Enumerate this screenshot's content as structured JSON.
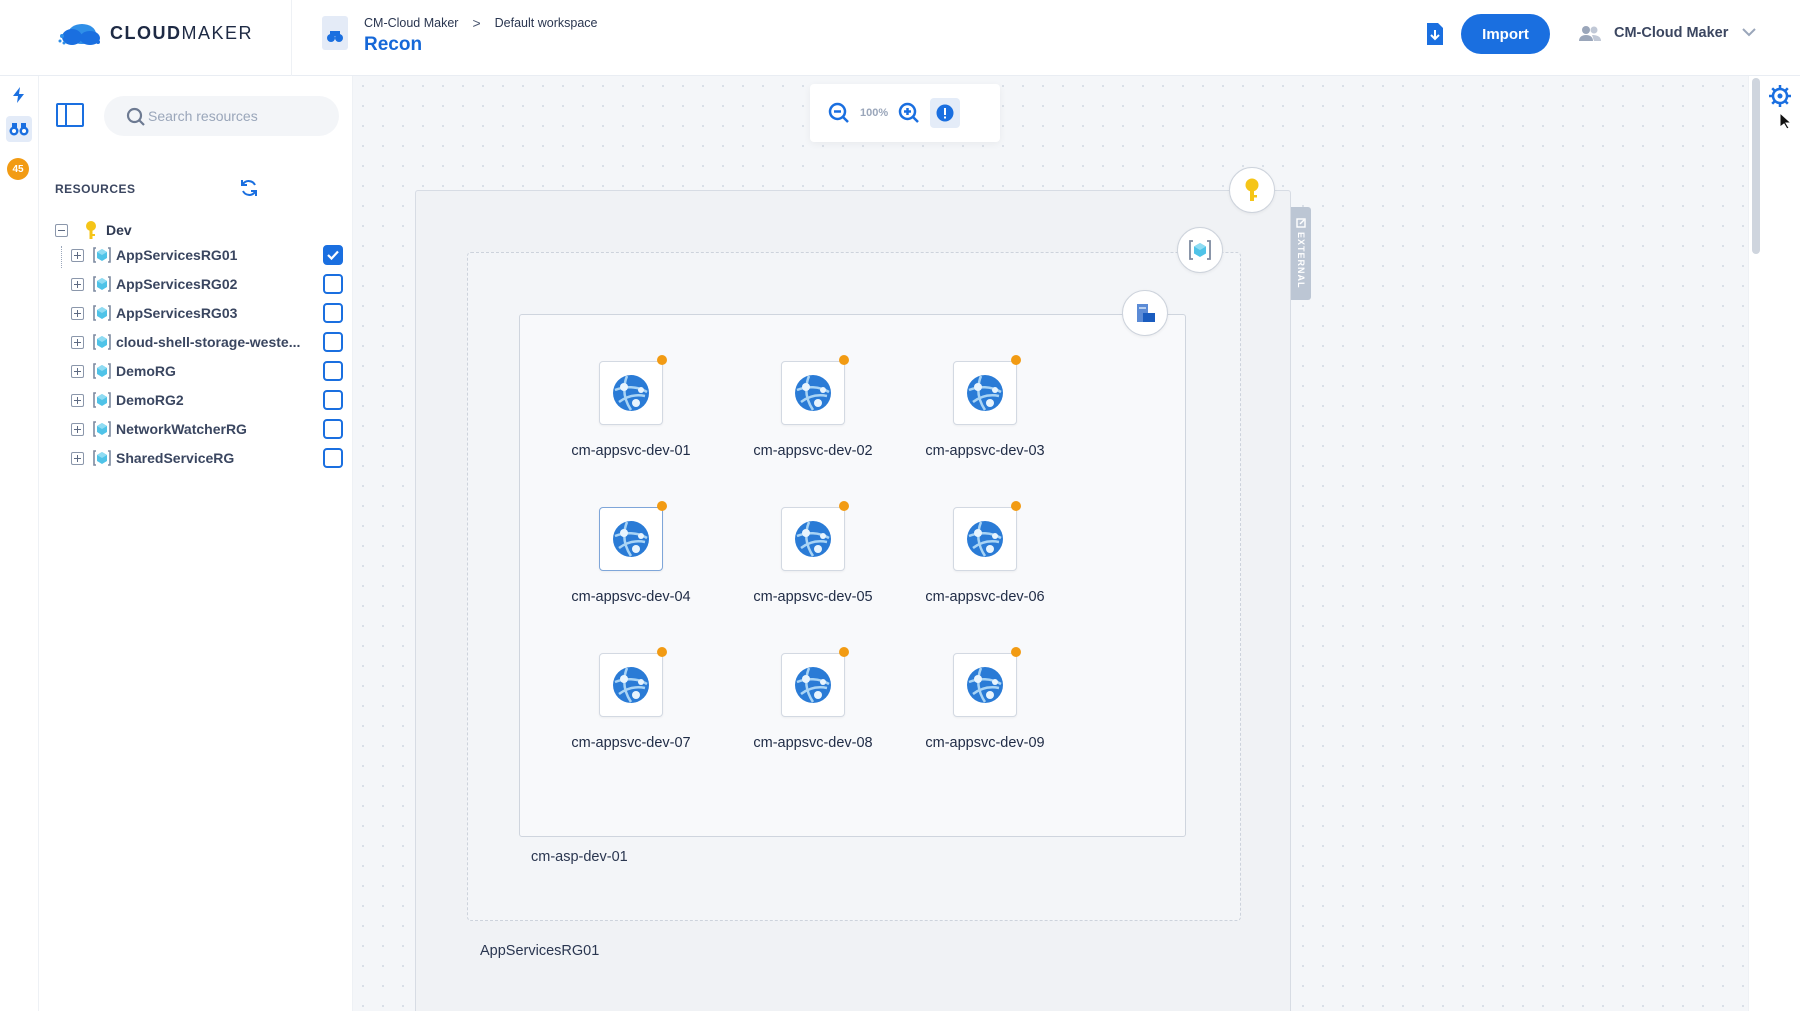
{
  "app": {
    "logo_text_bold": "CLOUD",
    "logo_text_light": "MAKER"
  },
  "header": {
    "breadcrumb_parent": "CM-Cloud Maker",
    "breadcrumb_separator": ">",
    "breadcrumb_current": "Default workspace",
    "page_title": "Recon",
    "import_label": "Import",
    "user_name": "CM-Cloud Maker"
  },
  "rail": {
    "badge_count": "45"
  },
  "sidebar": {
    "search_placeholder": "Search resources",
    "resources_label": "RESOURCES",
    "root_label": "Dev",
    "items": [
      {
        "label": "AppServicesRG01",
        "checked": true
      },
      {
        "label": "AppServicesRG02",
        "checked": false
      },
      {
        "label": "AppServicesRG03",
        "checked": false
      },
      {
        "label": "cloud-shell-storage-weste...",
        "checked": false
      },
      {
        "label": "DemoRG",
        "checked": false
      },
      {
        "label": "DemoRG2",
        "checked": false
      },
      {
        "label": "NetworkWatcherRG",
        "checked": false
      },
      {
        "label": "SharedServiceRG",
        "checked": false
      }
    ]
  },
  "canvas": {
    "zoom_level": "100%",
    "external_label": "EXTERNAL",
    "resource_group_label": "AppServicesRG01",
    "plan_label": "cm-asp-dev-01",
    "app_services": [
      {
        "label": "cm-appsvc-dev-01"
      },
      {
        "label": "cm-appsvc-dev-02"
      },
      {
        "label": "cm-appsvc-dev-03"
      },
      {
        "label": "cm-appsvc-dev-04"
      },
      {
        "label": "cm-appsvc-dev-05"
      },
      {
        "label": "cm-appsvc-dev-06"
      },
      {
        "label": "cm-appsvc-dev-07"
      },
      {
        "label": "cm-appsvc-dev-08"
      },
      {
        "label": "cm-appsvc-dev-09"
      }
    ]
  },
  "colors": {
    "accent": "#1a6fe0",
    "badge": "#f29b13",
    "status_dot": "#f29b13",
    "key": "#f5c518"
  }
}
